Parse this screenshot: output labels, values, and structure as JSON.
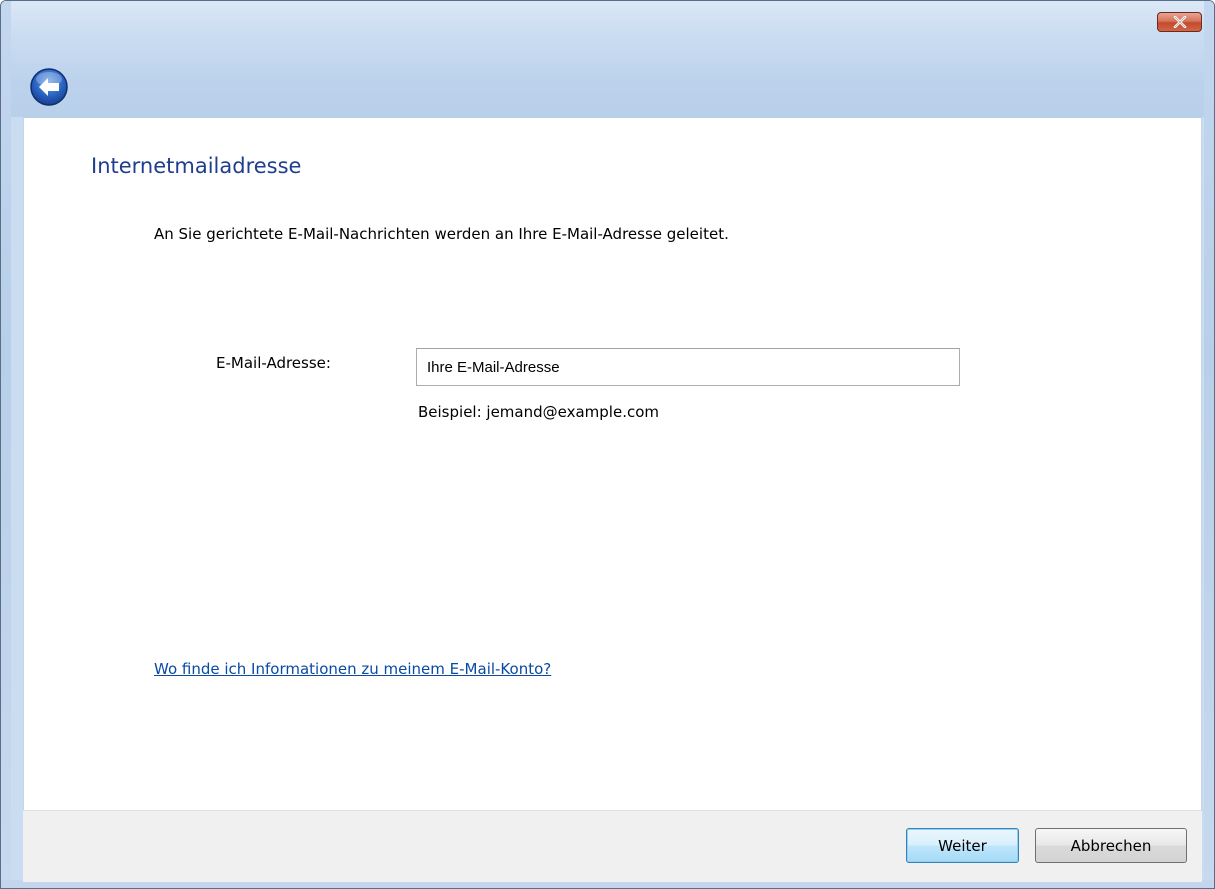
{
  "window": {
    "close_icon": "close-icon",
    "back_icon": "back-arrow-icon"
  },
  "page": {
    "title": "Internetmailadresse",
    "description": "An Sie gerichtete E-Mail-Nachrichten werden an Ihre E-Mail-Adresse geleitet."
  },
  "form": {
    "email_label": "E-Mail-Adresse:",
    "email_value": "Ihre E-Mail-Adresse",
    "example": "Beispiel: jemand@example.com"
  },
  "help": {
    "link_text": "Wo finde ich Informationen zu meinem E-Mail-Konto?"
  },
  "footer": {
    "next_label": "Weiter",
    "cancel_label": "Abbrechen"
  },
  "colors": {
    "title": "#1e3e8e",
    "link": "#0a49a6",
    "frame": "#c3d7ef",
    "close_button": "#c44a2c"
  }
}
